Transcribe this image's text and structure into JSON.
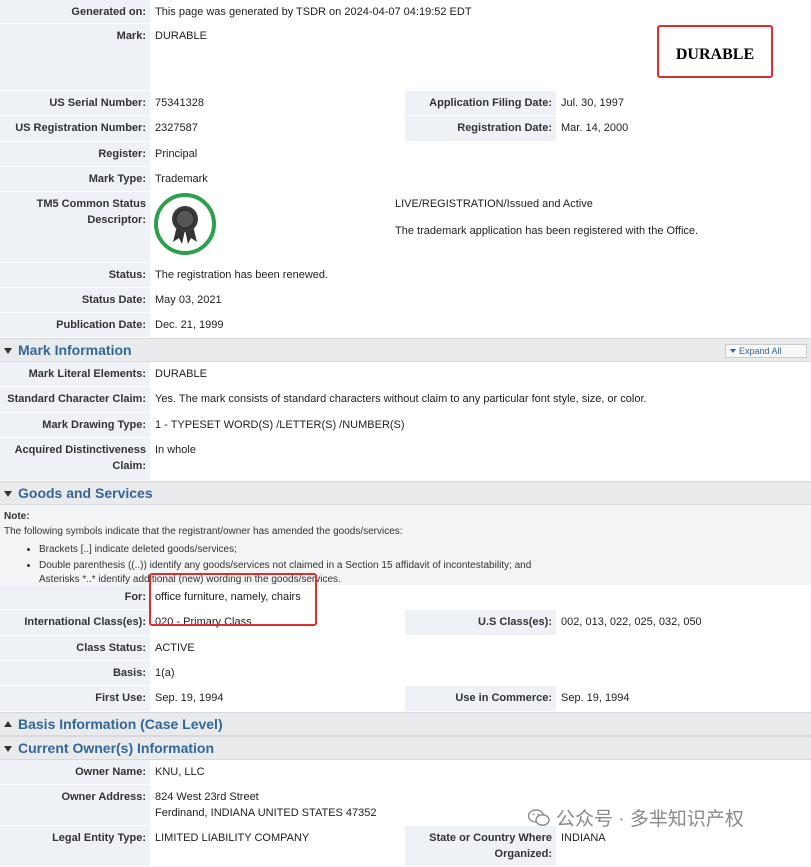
{
  "generated": {
    "label": "Generated on:",
    "value": "This page was generated by TSDR on 2024-04-07 04:19:52 EDT"
  },
  "mark": {
    "label": "Mark:",
    "value": "DURABLE",
    "image_text": "DURABLE"
  },
  "serial": {
    "label": "US Serial Number:",
    "value": "75341328",
    "label2": "Application Filing Date:",
    "value2": "Jul. 30, 1997"
  },
  "registration": {
    "label": "US Registration Number:",
    "value": "2327587",
    "label2": "Registration Date:",
    "value2": "Mar. 14, 2000"
  },
  "register": {
    "label": "Register:",
    "value": "Principal"
  },
  "mark_type": {
    "label": "Mark Type:",
    "value": "Trademark"
  },
  "tm5": {
    "label": "TM5 Common Status Descriptor:",
    "line1": "LIVE/REGISTRATION/Issued and Active",
    "line2": "The trademark application has been registered with the Office."
  },
  "status": {
    "label": "Status:",
    "value": "The registration has been renewed."
  },
  "status_date": {
    "label": "Status Date:",
    "value": "May 03, 2021"
  },
  "publication_date": {
    "label": "Publication Date:",
    "value": "Dec. 21, 1999"
  },
  "mark_info": {
    "title": "Mark Information",
    "expand_all": "Expand All",
    "literal": {
      "label": "Mark Literal Elements:",
      "value": "DURABLE"
    },
    "std_char": {
      "label": "Standard Character Claim:",
      "value": "Yes. The mark consists of standard characters without claim to any particular font style, size, or color."
    },
    "drawing": {
      "label": "Mark Drawing Type:",
      "value": "1 - TYPESET WORD(S) /LETTER(S) /NUMBER(S)"
    },
    "acquired": {
      "label": "Acquired Distinctiveness Claim:",
      "value": "In whole"
    }
  },
  "goods": {
    "title": "Goods and Services",
    "note_title": "Note:",
    "note_text": "The following symbols indicate that the registrant/owner has amended the goods/services:",
    "bullets": [
      "Brackets [..] indicate deleted goods/services;",
      "Double parenthesis ((..)) identify any goods/services not claimed in a Section 15 affidavit of incontestability; and",
      "Asterisks *..* identify additional (new) wording in the goods/services."
    ],
    "for": {
      "label": "For:",
      "value": "office furniture, namely, chairs"
    },
    "intl": {
      "label": "International Class(es):",
      "value": "020 - Primary Class",
      "label2": "U.S Class(es):",
      "value2": "002, 013, 022, 025, 032, 050"
    },
    "class_status": {
      "label": "Class Status:",
      "value": "ACTIVE"
    },
    "basis": {
      "label": "Basis:",
      "value": "1(a)"
    },
    "first_use": {
      "label": "First Use:",
      "value": "Sep. 19, 1994",
      "label2": "Use in Commerce:",
      "value2": "Sep. 19, 1994"
    }
  },
  "basis_info": {
    "title": "Basis Information (Case Level)"
  },
  "owner": {
    "title": "Current Owner(s) Information",
    "name": {
      "label": "Owner Name:",
      "value": "KNU, LLC"
    },
    "address": {
      "label": "Owner Address:",
      "line1": "824 West 23rd Street",
      "line2": "Ferdinand, INDIANA UNITED STATES 47352"
    },
    "entity": {
      "label": "Legal Entity Type:",
      "value": "LIMITED LIABILITY COMPANY",
      "label2": "State or Country Where Organized:",
      "value2": "INDIANA"
    }
  },
  "watermark": {
    "text": "公众号 · 多芈知识产权"
  },
  "colors": {
    "accent": "#336699",
    "highlight": "#d9302f",
    "badge_green": "#2e9e4f"
  }
}
